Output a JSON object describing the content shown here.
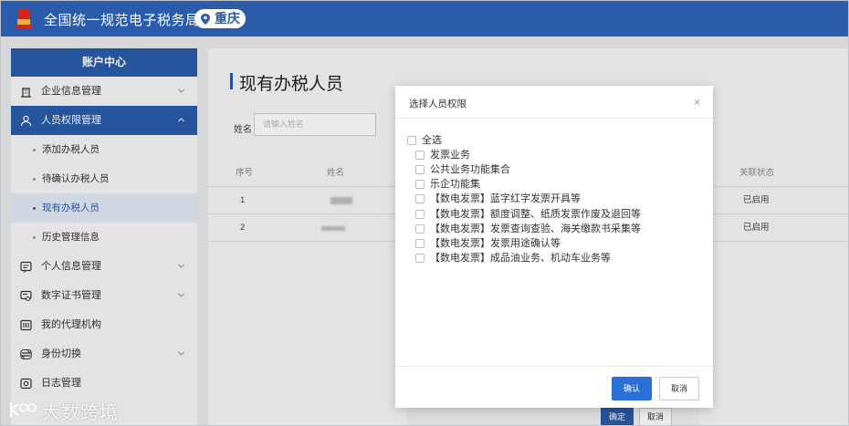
{
  "header": {
    "title": "全国统一规范电子税务局",
    "city": "重庆",
    "brand_color": "#2a5cab"
  },
  "sidebar": {
    "heading": "账户中心",
    "groups": [
      {
        "label": "企业信息管理",
        "icon": "building-icon",
        "expandable": true
      },
      {
        "label": "人员权限管理",
        "icon": "user-icon",
        "expandable": true,
        "expanded": true,
        "children": [
          {
            "label": "添加办税人员"
          },
          {
            "label": "待确认办税人员"
          },
          {
            "label": "现有办税人员",
            "current": true
          },
          {
            "label": "历史管理信息"
          }
        ]
      },
      {
        "label": "个人信息管理",
        "icon": "id-card-icon",
        "expandable": true
      },
      {
        "label": "数字证书管理",
        "icon": "certificate-icon",
        "expandable": true
      },
      {
        "label": "我的代理机构",
        "icon": "agency-icon",
        "expandable": false
      },
      {
        "label": "身份切换",
        "icon": "switch-icon",
        "expandable": true
      },
      {
        "label": "日志管理",
        "icon": "log-icon",
        "expandable": false
      }
    ]
  },
  "main": {
    "page_title": "现有办税人员",
    "search": {
      "label": "姓名",
      "placeholder": "请输入姓名"
    },
    "table": {
      "columns": [
        "序号",
        "姓名",
        "关联状态"
      ],
      "rows": [
        {
          "index": "1",
          "status": "已启用"
        },
        {
          "index": "2",
          "status": "已启用"
        }
      ]
    },
    "footer_buttons": {
      "ok": "确定",
      "cancel": "取消"
    }
  },
  "modal": {
    "title": "选择人员权限",
    "close": "×",
    "select_all": "全选",
    "options": [
      "发票业务",
      "公共业务功能集合",
      "乐企功能集",
      "【数电发票】蓝字红字发票开具等",
      "【数电发票】额度调整、纸质发票作废及退回等",
      "【数电发票】发票查询查验、海关缴款书采集等",
      "【数电发票】发票用途确认等",
      "【数电发票】成品油业务、机动车业务等"
    ],
    "confirm": "确认",
    "cancel": "取消"
  },
  "watermark": "大数跨境"
}
